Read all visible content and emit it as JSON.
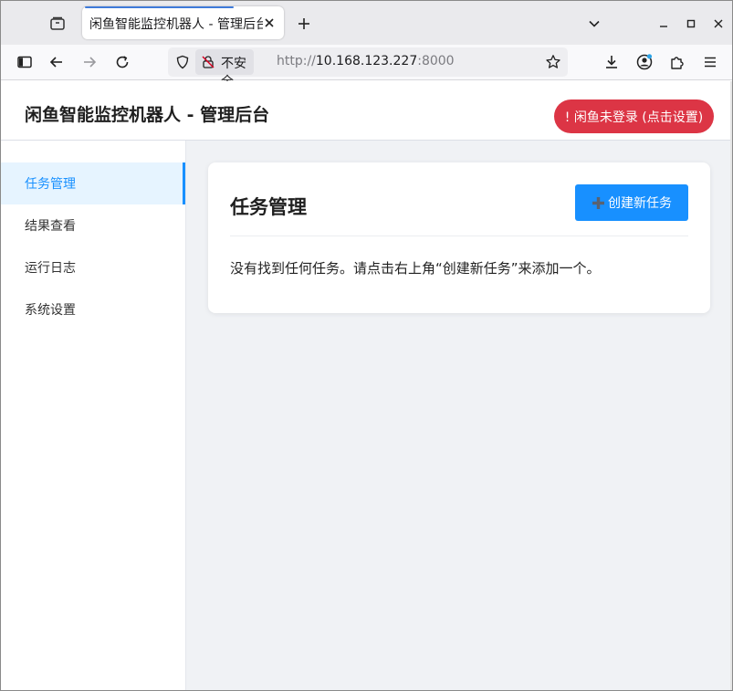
{
  "browser": {
    "tab_title": "闲鱼智能监控机器人 - 管理后台",
    "url_security_label": "不安全",
    "url_scheme": "http://",
    "url_host": "10.168.123.227",
    "url_port": ":8000"
  },
  "app": {
    "title": "闲鱼智能监控机器人 - 管理后台",
    "login_badge": "! 闲鱼未登录 (点击设置)"
  },
  "sidebar": {
    "items": [
      {
        "label": "任务管理",
        "active": true
      },
      {
        "label": "结果查看",
        "active": false
      },
      {
        "label": "运行日志",
        "active": false
      },
      {
        "label": "系统设置",
        "active": false
      }
    ]
  },
  "main": {
    "card_title": "任务管理",
    "create_button_label": "创建新任务",
    "empty_message": "没有找到任何任务。请点击右上角“创建新任务”来添加一个。"
  },
  "colors": {
    "primary": "#1890ff",
    "danger": "#dc3545",
    "active_bg": "#e6f4ff",
    "page_bg": "#f0f2f5"
  }
}
